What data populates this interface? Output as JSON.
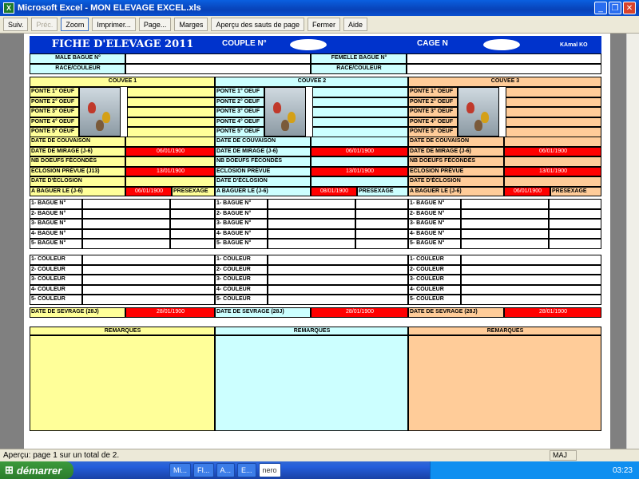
{
  "window": {
    "title": "Microsoft Excel - MON ELEVAGE EXCEL.xls"
  },
  "toolbar": {
    "suiv": "Suiv.",
    "prec": "Préc.",
    "zoom": "Zoom",
    "imprimer": "Imprimer...",
    "page": "Page...",
    "marges": "Marges",
    "apercu": "Aperçu des sauts de page",
    "fermer": "Fermer",
    "aide": "Aide"
  },
  "sheet": {
    "title": "FICHE D'ELEVAGE 2011",
    "couple": "COUPLE N°",
    "cage": "CAGE  N",
    "author": "KAmal KO",
    "male": "MALE BAGUE N°",
    "femelle": "FEMELLE BAGUE N°",
    "race": "RACE/COULEUR",
    "race2": "RACE/COULEUR",
    "couvees": [
      {
        "title": "COUVEE 1",
        "date_mirage": "06/01/1900",
        "eclosion_prevue": "13/01/1900",
        "a_baguer": "06/01/1900",
        "sevrage": "28/01/1900",
        "eclosion_label": "ECLOSION PRÉVUE (J13)"
      },
      {
        "title": "COUVEE 2",
        "date_mirage": "06/01/1900",
        "eclosion_prevue": "13/01/1900",
        "a_baguer": "08/01/1900",
        "sevrage": "28/01/1900",
        "eclosion_label": "ECLOSION PRÉVUE"
      },
      {
        "title": "COUVEE 3",
        "date_mirage": "06/01/1900",
        "eclosion_prevue": "13/01/1900",
        "a_baguer": "06/01/1900",
        "sevrage": "28/01/1900",
        "eclosion_label": "ECLOSION PRÉVUE"
      }
    ],
    "pontes": [
      "PONTE 1° OEUF",
      "PONTE 2° OEUF",
      "PONTE 3° OEUF",
      "PONTE 4° OEUF",
      "PONTE 5° OEUF"
    ],
    "date_couvaison": "DATE DE COUVAISON",
    "date_mirage": "DATE DE MIRAGE  (J-6)",
    "nb_oeufs": "NB DOEUFS FÉCONDÉS",
    "date_eclosion": "DATE D'ÉCLOSION",
    "a_baguer": "A BAGUER LE  (J-6)",
    "presexage": "PRESEXAGE",
    "bagues": [
      "1- BAGUE  N°",
      "2- BAGUE  N°",
      "3- BAGUE  N°",
      "4- BAGUE  N°",
      "5- BAGUE  N°"
    ],
    "couleurs": [
      "1- COULEUR",
      "2- COULEUR",
      "3- COULEUR",
      "4- COULEUR",
      "5- COULEUR"
    ],
    "sevrage": "DATE DE SEVRAGE (28J)",
    "remarques": "REMARQUES"
  },
  "status": {
    "text": "Aperçu: page 1 sur un total de 2.",
    "maj": "MAJ"
  },
  "taskbar": {
    "start": "démarrer",
    "items": [
      "Mi...",
      "FI...",
      "A...",
      "E..."
    ],
    "nero": "nero",
    "clock": "03:23"
  },
  "colors": {
    "col1": "#ffff99",
    "col2": "#ccffff",
    "col3": "#ffcc99",
    "red": "#ff0000",
    "header": "#0033cc"
  }
}
